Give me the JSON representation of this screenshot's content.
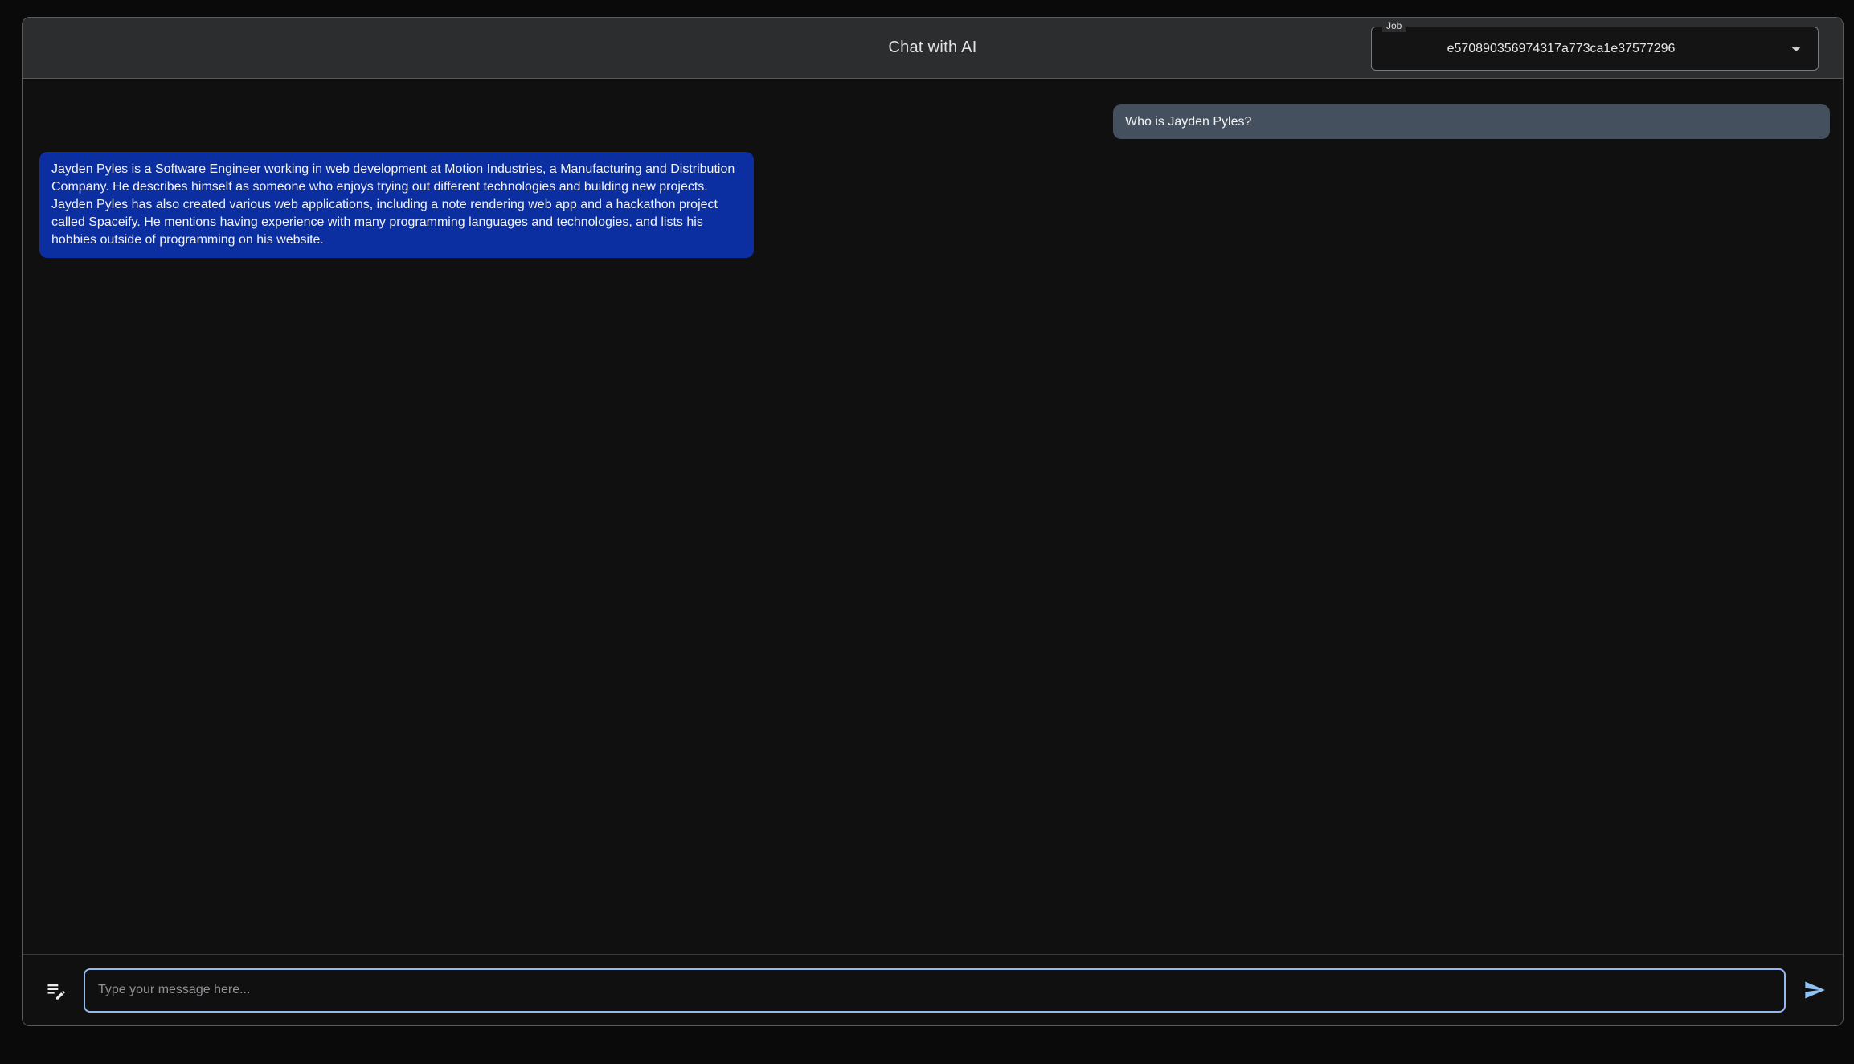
{
  "header": {
    "title": "Chat with AI",
    "job_field": {
      "label": "Job",
      "value": "e570890356974317a773ca1e37577296",
      "dropdown_icon": "arrow-drop-down-icon"
    }
  },
  "messages": [
    {
      "role": "user",
      "text": "Who is Jayden Pyles?"
    },
    {
      "role": "assistant",
      "text": "Jayden Pyles is a Software Engineer working in web development at Motion Industries, a Manufacturing and Distribution Company. He describes himself as someone who enjoys trying out different technologies and building new projects. Jayden Pyles has also created various web applications, including a note rendering web app and a hackathon project called Spaceify. He mentions having experience with many programming languages and technologies, and lists his hobbies outside of programming on his website."
    }
  ],
  "composer": {
    "placeholder": "Type your message here...",
    "new_chat_icon": "edit-note-icon",
    "send_icon": "send-icon"
  },
  "colors": {
    "page_bg": "#0a0a0a",
    "frame_bg": "#101010",
    "frame_border": "#585b5e",
    "header_bg": "#2c2d2f",
    "user_bubble_bg": "#44505e",
    "assistant_bubble_bg": "#0b2fa1",
    "message_text": "#f2f2f2",
    "input_border": "#93b9f1",
    "send_icon": "#90c1f2",
    "placeholder_text": "#8e9297"
  }
}
